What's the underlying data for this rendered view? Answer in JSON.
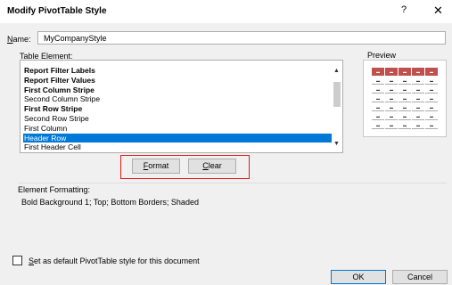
{
  "title": "Modify PivotTable Style",
  "help_label": "?",
  "name_label_key": "N",
  "name_label_rest": "ame:",
  "name_value": "MyCompanyStyle",
  "table_element_label_key": "T",
  "table_element_label_rest": "able Element:",
  "table_elements": [
    {
      "label": "Report Filter Labels",
      "bold": true,
      "selected": false
    },
    {
      "label": "Report Filter Values",
      "bold": true,
      "selected": false
    },
    {
      "label": "First Column Stripe",
      "bold": true,
      "selected": false
    },
    {
      "label": "Second Column Stripe",
      "bold": false,
      "selected": false
    },
    {
      "label": "First Row Stripe",
      "bold": true,
      "selected": false
    },
    {
      "label": "Second Row Stripe",
      "bold": false,
      "selected": false
    },
    {
      "label": "First Column",
      "bold": false,
      "selected": false
    },
    {
      "label": "Header Row",
      "bold": false,
      "selected": true
    },
    {
      "label": "First Header Cell",
      "bold": false,
      "selected": false
    }
  ],
  "format_key": "F",
  "format_rest": "ormat",
  "clear_key": "C",
  "clear_rest": "lear",
  "preview_label": "Preview",
  "element_formatting_label": "Element Formatting:",
  "element_formatting_text": "Bold Background 1; Top; Bottom Borders; Shaded",
  "default_checkbox_key": "S",
  "default_checkbox_rest": "et as default PivotTable style for this document",
  "default_checked": false,
  "ok_label": "OK",
  "cancel_label": "Cancel",
  "preview_header_color": "#c0504d",
  "selection_color": "#0078d7",
  "highlight_frame_color": "#e31b1b"
}
